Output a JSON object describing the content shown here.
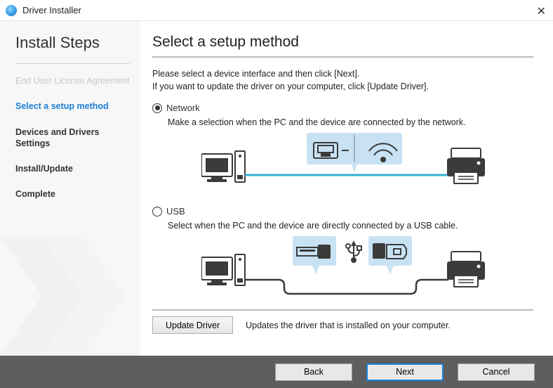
{
  "window": {
    "title": "Driver Installer",
    "close_glyph": "✕"
  },
  "sidebar": {
    "heading": "Install Steps",
    "steps": [
      {
        "label": "End User License Agreement",
        "state": "disabled"
      },
      {
        "label": "Select a setup method",
        "state": "active"
      },
      {
        "label": "Devices and Drivers Settings",
        "state": "normal"
      },
      {
        "label": "Install/Update",
        "state": "normal"
      },
      {
        "label": "Complete",
        "state": "normal"
      }
    ]
  },
  "main": {
    "heading": "Select a setup method",
    "intro_line1": "Please select a device interface and then click [Next].",
    "intro_line2": "If you want to update the driver on your computer, click [Update Driver].",
    "options": {
      "network": {
        "label": "Network",
        "desc": "Make a selection when the PC and the device are connected by the network.",
        "selected": true
      },
      "usb": {
        "label": "USB",
        "desc": "Select when the PC and the device are directly connected by a USB cable.",
        "selected": false
      }
    },
    "update": {
      "button": "Update Driver",
      "desc": "Updates the driver that is installed on your computer."
    }
  },
  "buttons": {
    "back": "Back",
    "next": "Next",
    "cancel": "Cancel"
  }
}
